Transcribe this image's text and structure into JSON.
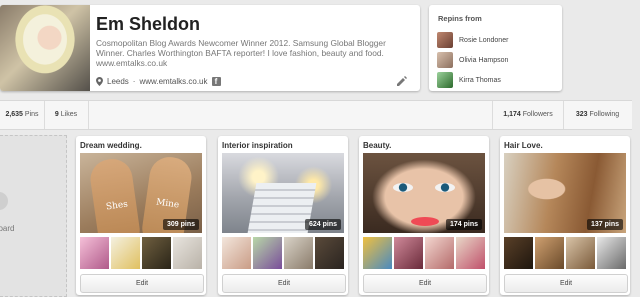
{
  "profile": {
    "name": "Em Sheldon",
    "bio": "Cosmopolitan Blog Awards Newcomer Winner 2012. Samsung Global Blogger Winner. Charles Worthington BAFTA reporter! I love fashion, beauty and food. www.emtalks.co.uk",
    "location": "Leeds",
    "separator": "·",
    "website": "www.emtalks.co.uk",
    "facebook_glyph": "f",
    "icons": {
      "location": "map-pin-icon",
      "facebook": "facebook-icon",
      "edit": "pencil-icon"
    }
  },
  "repins": {
    "title": "Repins from",
    "users": [
      {
        "name": "Rosie Londoner",
        "color": "#8b5a4a"
      },
      {
        "name": "Olivia Hampson",
        "color": "#b79a86"
      },
      {
        "name": "Kirra Thomas",
        "color": "#4a8a4a"
      }
    ]
  },
  "stats": {
    "pins_count": "2,635",
    "pins_label": "Pins",
    "likes_count": "9",
    "likes_label": "Likes",
    "followers_count": "1,174",
    "followers_label": "Followers",
    "following_count": "323",
    "following_label": "Following"
  },
  "create_board": {
    "label": "board"
  },
  "boards": [
    {
      "title": "Dream wedding.",
      "pins": "309 pins",
      "edit_label": "Edit"
    },
    {
      "title": "Interior inspiration",
      "pins": "624 pins",
      "edit_label": "Edit"
    },
    {
      "title": "Beauty.",
      "pins": "174 pins",
      "edit_label": "Edit"
    },
    {
      "title": "Hair Love.",
      "pins": "137 pins",
      "edit_label": "Edit"
    }
  ],
  "wedding_cover_text": {
    "left": "Shes",
    "right": "Mine"
  },
  "colors": {
    "background": "#eaeaea",
    "card": "#ffffff",
    "count_badge": "#000000"
  }
}
